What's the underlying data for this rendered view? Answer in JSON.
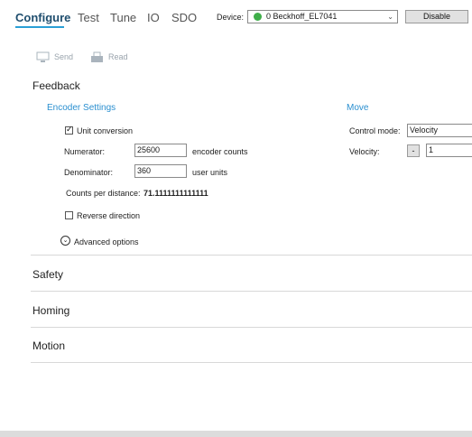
{
  "tabs": [
    {
      "label": "Configure",
      "active": true
    },
    {
      "label": "Test"
    },
    {
      "label": "Tune"
    },
    {
      "label": "IO"
    },
    {
      "label": "SDO"
    }
  ],
  "device": {
    "label": "Device:",
    "selected": "0 Beckhoff_EL7041",
    "status_color": "#3fae49"
  },
  "disable_label": "Disable",
  "toolbar": {
    "send_label": "Send",
    "read_label": "Read"
  },
  "feedback": {
    "title": "Feedback",
    "encoder_settings": "Encoder Settings",
    "unit_conversion": {
      "label": "Unit conversion",
      "checked": true
    },
    "numerator": {
      "label": "Numerator:",
      "value": "25600",
      "unit": "encoder counts"
    },
    "denominator": {
      "label": "Denominator:",
      "value": "360",
      "unit": "user units"
    },
    "counts_per_distance": {
      "label": "Counts per distance:",
      "value": "71.1111111111111"
    },
    "reverse_direction": {
      "label": "Reverse direction",
      "checked": false
    },
    "advanced_options": "Advanced options"
  },
  "move": {
    "title": "Move",
    "control_mode_label": "Control mode:",
    "control_mode_value": "Velocity",
    "velocity_label": "Velocity:",
    "velocity_minus": "-",
    "velocity_value": "1"
  },
  "sections": [
    "Safety",
    "Homing",
    "Motion"
  ],
  "colors": {
    "accent": "#2a9fd6",
    "link": "#2a8fd0",
    "active_tab": "#1f4e6e"
  }
}
